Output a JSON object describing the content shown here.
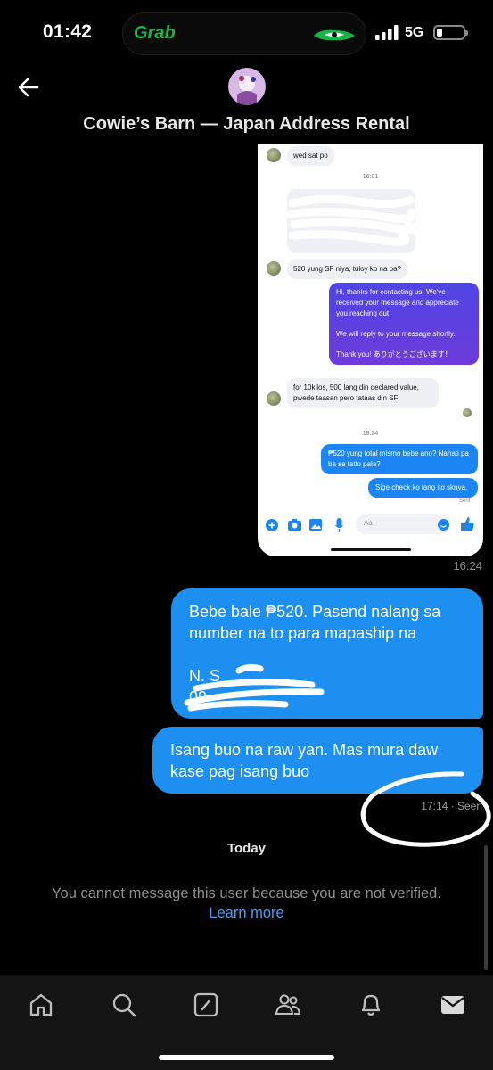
{
  "status_bar": {
    "time": "01:42",
    "live_activity_app": "Grab",
    "network": "5G"
  },
  "header": {
    "title": "Cowie’s Barn — Japan Address Rental",
    "back_icon": "arrow-left-icon"
  },
  "attachment": {
    "incoming_1": "wed sat po",
    "time_1": "16:01",
    "incoming_2": "520 yung SF niya, tuloy ko na ba?",
    "auto_reply": {
      "line1": "Hi, thanks for contacting us. We've received your message and appreciate you reaching out.",
      "line2": "We will reply to your message shortly.",
      "line3": "Thank you! ありがとうございます！"
    },
    "incoming_3": "for 10kilos, 500 lang din declared value, pwede taasan pero tataas din SF",
    "time_2": "18:24",
    "outgoing_1": "₱520 yung total mismo bebe ano? Nahati pa ba sa tatlo pala?",
    "outgoing_2": "Sige check ko lang ito sknya.",
    "sent_label": "Sent",
    "input_placeholder": "Aa",
    "timestamp": "16:24"
  },
  "messages": {
    "msg1_line1": "Bebe bale ₱520. Pasend nalang sa number na to para mapaship na",
    "msg1_line2": "N. S",
    "msg1_line3": "09",
    "msg2": "Isang buo na raw yan. Mas mura daw kase pag isang buo",
    "time": "17:14",
    "status": "· Seen"
  },
  "day_separator": "Today",
  "notice": "You cannot message this user because you are not verified.",
  "learn_more": "Learn more",
  "bottom_nav": [
    "home-icon",
    "search-icon",
    "compose-icon",
    "people-icon",
    "bell-icon",
    "mail-icon"
  ],
  "colors": {
    "accent": "#1d8ff0",
    "link": "#4a9ff5",
    "background": "#000000"
  }
}
